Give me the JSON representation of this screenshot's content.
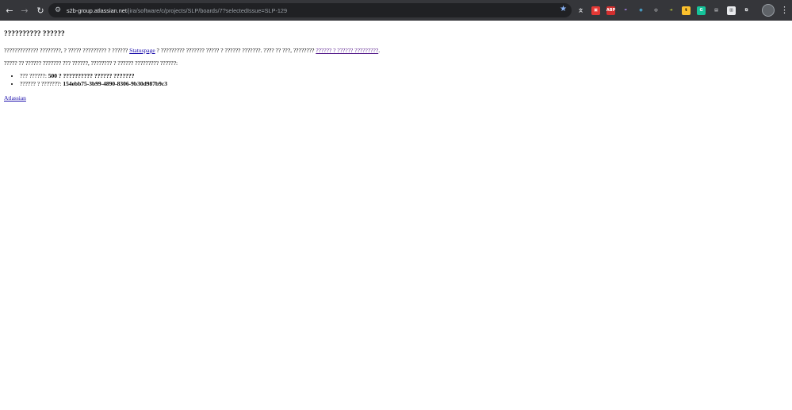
{
  "browser": {
    "url_host": "s2b-group.atlassian.net",
    "url_path": "/jira/software/c/projects/SLP/boards/7?selectedIssue=SLP-129",
    "icons": {
      "back": "arrow-left",
      "forward": "arrow-right",
      "reload": "reload",
      "site_info": "tune",
      "bookmark": "star",
      "menu": "kebab"
    },
    "extensions": [
      {
        "name": "translate-extension-icon",
        "glyph": "文",
        "color": "#35363a",
        "fg": "#e8eaed"
      },
      {
        "name": "red-extension-icon",
        "glyph": "▣",
        "color": "#e53935",
        "fg": "#ffffff"
      },
      {
        "name": "adblock-icon",
        "glyph": "ABP",
        "color": "#d32f2f",
        "fg": "#ffffff"
      },
      {
        "name": "feather-extension-icon",
        "glyph": "✒",
        "color": "#35363a",
        "fg": "#b388ff"
      },
      {
        "name": "blue-circle-extension-icon",
        "glyph": "◉",
        "color": "#35363a",
        "fg": "#4fc3f7"
      },
      {
        "name": "chrome-extension-icon",
        "glyph": "◎",
        "color": "#35363a",
        "fg": "#e8eaed"
      },
      {
        "name": "arrow-extension-icon",
        "glyph": "➜",
        "color": "#35363a",
        "fg": "#cddc39"
      },
      {
        "name": "yellow-extension-icon",
        "glyph": "t",
        "color": "#fbc02d",
        "fg": "#000000"
      },
      {
        "name": "grammarly-icon",
        "glyph": "G",
        "color": "#15c39a",
        "fg": "#ffffff"
      },
      {
        "name": "clipboard-extension-icon",
        "glyph": "▤",
        "color": "#35363a",
        "fg": "#e8eaed"
      },
      {
        "name": "white-square-extension-icon",
        "glyph": "▥",
        "color": "#e8eaed",
        "fg": "#35363a"
      },
      {
        "name": "puzzle-extensions-icon",
        "glyph": "⧉",
        "color": "#35363a",
        "fg": "#e8eaed"
      }
    ]
  },
  "page": {
    "title": "?????????? ??????",
    "p1_before": "????????????? ????????, ? ????? ????????? ? ?????? ",
    "p1_link": "Statuspage",
    "p1_middle": " ? ????????? ??????? ????? ? ?????? ???????. ???? ?? ???, ???????? ",
    "p1_link2": "?????? ? ?????? ?????????",
    "p1_end": ".",
    "p2": "????? ?? ?????? ??????? ??? ??????, ???????? ? ?????? ????????? ??????:",
    "items": [
      {
        "label": "??? ??????: ",
        "value": "500 ? ?????????? ?????? ???????"
      },
      {
        "label": "?????? ? ???????: ",
        "value": "154ebb75-3b99-4890-8306-9b30d987b9c3"
      }
    ],
    "footer_link": "Atlassian"
  }
}
